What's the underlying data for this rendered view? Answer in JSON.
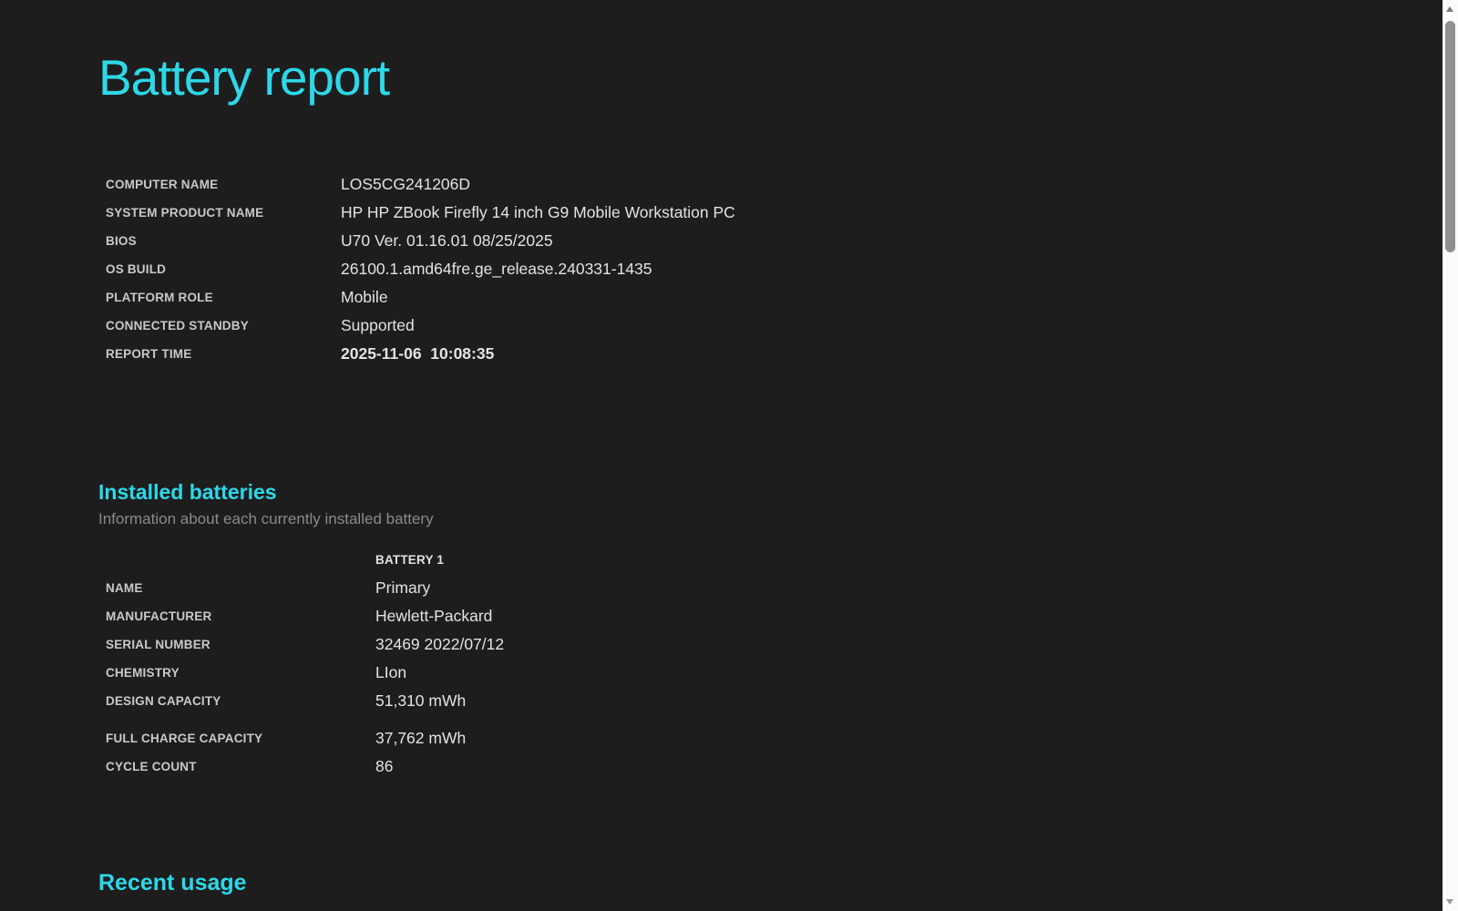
{
  "colors": {
    "accent": "#2dd8e8",
    "background": "#1d1d1d",
    "label_text": "#c9c9c9",
    "value_text": "#e3e3e3",
    "subtitle_text": "#8a8a8a",
    "scrollbar_track": "#fbfbfb",
    "scrollbar_thumb": "#8f8f8f"
  },
  "page": {
    "title": "Battery report"
  },
  "system_info": {
    "rows": [
      {
        "label": "COMPUTER NAME",
        "value": "LOS5CG241206D"
      },
      {
        "label": "SYSTEM PRODUCT NAME",
        "value": "HP HP ZBook Firefly 14 inch G9 Mobile Workstation PC"
      },
      {
        "label": "BIOS",
        "value": "U70 Ver. 01.16.01 08/25/2025"
      },
      {
        "label": "OS BUILD",
        "value": "26100.1.amd64fre.ge_release.240331-1435"
      },
      {
        "label": "PLATFORM ROLE",
        "value": "Mobile"
      },
      {
        "label": "CONNECTED STANDBY",
        "value": "Supported"
      },
      {
        "label": "REPORT TIME",
        "value": "2025-11-06  10:08:35"
      }
    ]
  },
  "installed_batteries": {
    "heading": "Installed batteries",
    "subtitle": "Information about each currently installed battery",
    "column_header": "BATTERY 1",
    "rows": [
      {
        "label": "NAME",
        "value": "Primary"
      },
      {
        "label": "MANUFACTURER",
        "value": "Hewlett-Packard"
      },
      {
        "label": "SERIAL NUMBER",
        "value": "32469 2022/07/12"
      },
      {
        "label": "CHEMISTRY",
        "value": "LIon"
      },
      {
        "label": "DESIGN CAPACITY",
        "value": "51,310 mWh"
      }
    ],
    "rows2": [
      {
        "label": "FULL CHARGE CAPACITY",
        "value": "37,762 mWh"
      },
      {
        "label": "CYCLE COUNT",
        "value": "86"
      }
    ]
  },
  "recent_usage": {
    "heading": "Recent usage"
  }
}
